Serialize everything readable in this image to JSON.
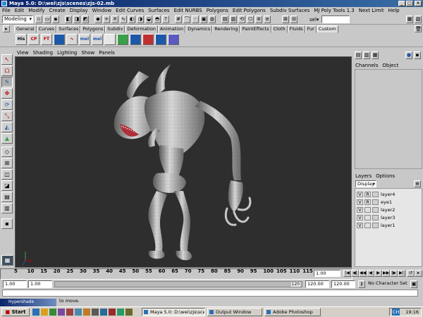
{
  "window": {
    "title": "Maya 5.0: D:\\wei\\zjs\\scenes\\zjs-02.mb",
    "minimize": "_",
    "maximize": "□",
    "close": "×"
  },
  "menu": [
    "File",
    "Edit",
    "Modify",
    "Create",
    "Display",
    "Window",
    "Edit Curves",
    "Surfaces",
    "Edit NURBS",
    "Polygons",
    "Edit Polygons",
    "Subdiv Surfaces",
    "MJ Poly Tools 1.3",
    "Next Limit",
    "Help"
  ],
  "status_line": {
    "mode": "Modeling",
    "sel_label": "sel▾",
    "sel_value": ""
  },
  "shelf_tabs": [
    {
      "label": "General",
      "active": false
    },
    {
      "label": "Curves",
      "active": false
    },
    {
      "label": "Surfaces",
      "active": false
    },
    {
      "label": "Polygons",
      "active": false
    },
    {
      "label": "Subdiv",
      "active": false
    },
    {
      "label": "Deformation",
      "active": false
    },
    {
      "label": "Animation",
      "active": false
    },
    {
      "label": "Dynamics",
      "active": false
    },
    {
      "label": "Rendering",
      "active": false
    },
    {
      "label": "PaintEffects",
      "active": false
    },
    {
      "label": "Cloth",
      "active": false
    },
    {
      "label": "Fluids",
      "active": false
    },
    {
      "label": "Fur",
      "active": false
    },
    {
      "label": "Custom",
      "active": true
    }
  ],
  "shelf_buttons": [
    "His",
    "CP",
    "FT",
    "",
    "",
    "mel",
    "mel",
    "",
    ""
  ],
  "panel_menu": [
    "View",
    "Shading",
    "Lighting",
    "Show",
    "Panels"
  ],
  "channel_box": {
    "tabs": [
      "Channels",
      "Object"
    ]
  },
  "layer_editor": {
    "tabs": [
      "Layers",
      "Options"
    ],
    "display": "Display",
    "layers": [
      {
        "v": "V",
        "r": "R",
        "name": "layer4"
      },
      {
        "v": "V",
        "r": "R",
        "name": "eye1"
      },
      {
        "v": "V",
        "r": "",
        "name": "layer2"
      },
      {
        "v": "V",
        "r": "",
        "name": "layer3"
      },
      {
        "v": "V",
        "r": "",
        "name": "layer1"
      }
    ]
  },
  "time_slider": {
    "ticks": [
      "5",
      "10",
      "15",
      "20",
      "25",
      "30",
      "35",
      "40",
      "45",
      "50",
      "55",
      "60",
      "65",
      "70",
      "75",
      "80",
      "85",
      "90",
      "95",
      "100",
      "105",
      "110",
      "115"
    ],
    "current_time": "1.00"
  },
  "range": {
    "start": "1.00",
    "playback_start": "1.00",
    "slider_end": "120",
    "playback_end": "120.00",
    "end": "120.00",
    "character_set": "No Character Set"
  },
  "help_line": "to move.",
  "hypershade_title": "Hypershade",
  "taskbar": {
    "start": "Start",
    "tasks": [
      "Maya 5.0: D:\\wei\\zjs\\sce...",
      "Output Window",
      "Adobe Photoshop"
    ],
    "tray_lang": "CH",
    "clock": "19:16"
  },
  "colors": {
    "viewport_bg": "#2e2e2e",
    "ui_bg": "#c8c8c8",
    "title_start": "#0a246a",
    "title_end": "#3a6ea5"
  },
  "icons": {
    "select_tool": "arrow-icon",
    "lasso_tool": "lasso-icon",
    "paint_tool": "brush-icon",
    "move_tool": "move-icon",
    "rotate_tool": "rotate-icon",
    "scale_tool": "scale-icon"
  }
}
